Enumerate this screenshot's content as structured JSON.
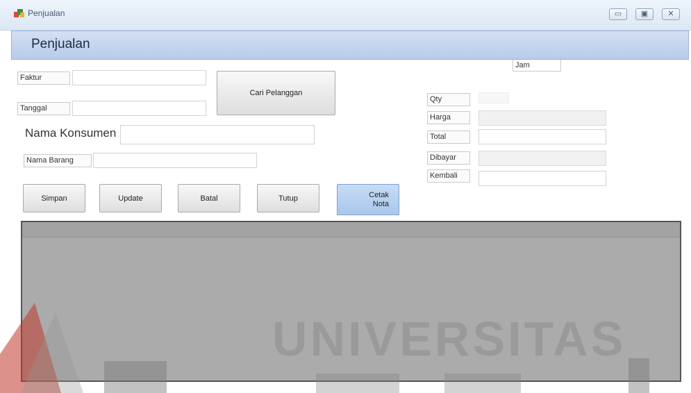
{
  "window": {
    "title": "Penjualan",
    "controls": {
      "minimize": "▭",
      "maximize": "▣",
      "close": "✕"
    }
  },
  "header": {
    "title": "Penjualan"
  },
  "form": {
    "faktur": {
      "label": "Faktur",
      "value": ""
    },
    "tanggal": {
      "label": "Tanggal",
      "value": ""
    },
    "nama_konsumen": {
      "label": "Nama Konsumen",
      "value": ""
    },
    "nama_barang": {
      "label": "Nama Barang",
      "value": ""
    },
    "cari_pelanggan_label": "Cari Pelanggan"
  },
  "summary": {
    "jam": {
      "label": "Jam",
      "value": ""
    },
    "qty": {
      "label": "Qty",
      "value": ""
    },
    "harga": {
      "label": "Harga",
      "value": ""
    },
    "total": {
      "label": "Total",
      "value": ""
    },
    "dibayar": {
      "label": "Dibayar",
      "value": ""
    },
    "kembali": {
      "label": "Kembali",
      "value": ""
    }
  },
  "buttons": {
    "simpan": "Simpan",
    "update": "Update",
    "batal": "Batal",
    "tutup": "Tutup",
    "cetak_nota": "Cetak\nNota"
  },
  "watermark": {
    "text": "UNIVERSITAS"
  },
  "colors": {
    "header_band": "#b8cbe9",
    "cetak_button": "#a9c7ec",
    "grid_background": "#ababab",
    "watermark_red": "#c0392b"
  }
}
